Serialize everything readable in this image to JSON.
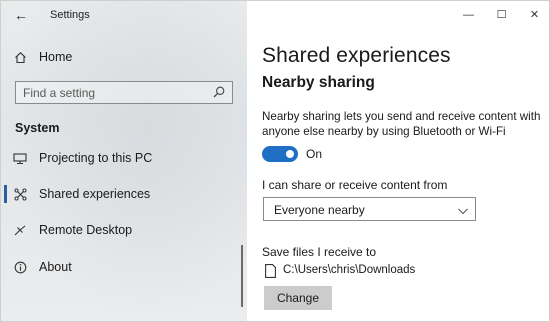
{
  "window": {
    "title": "Settings",
    "controls": {
      "minimize": "—",
      "maximize": "☐",
      "close": "✕"
    }
  },
  "sidebar": {
    "back_glyph": "←",
    "home_label": "Home",
    "search_placeholder": "Find a setting",
    "section_title": "System",
    "items": [
      {
        "label": "Projecting to this PC",
        "icon": "projector-icon"
      },
      {
        "label": "Shared experiences",
        "icon": "shared-experiences-icon",
        "active": true
      },
      {
        "label": "Remote Desktop",
        "icon": "remote-desktop-icon"
      },
      {
        "label": "About",
        "icon": "info-icon"
      }
    ]
  },
  "main": {
    "page_title": "Shared experiences",
    "section_title": "Nearby sharing",
    "description": "Nearby sharing lets you send and receive content with anyone else nearby by using Bluetooth or Wi-Fi",
    "toggle": {
      "state": "On",
      "on": true
    },
    "share_from_label": "I can share or receive content from",
    "share_from_value": "Everyone nearby",
    "save_label": "Save files I receive to",
    "save_path": "C:\\Users\\chris\\Downloads",
    "change_button": "Change"
  },
  "colors": {
    "accent": "#1f6fc5",
    "active_indicator": "#2a5f9e",
    "button_bg": "#cccccc"
  }
}
